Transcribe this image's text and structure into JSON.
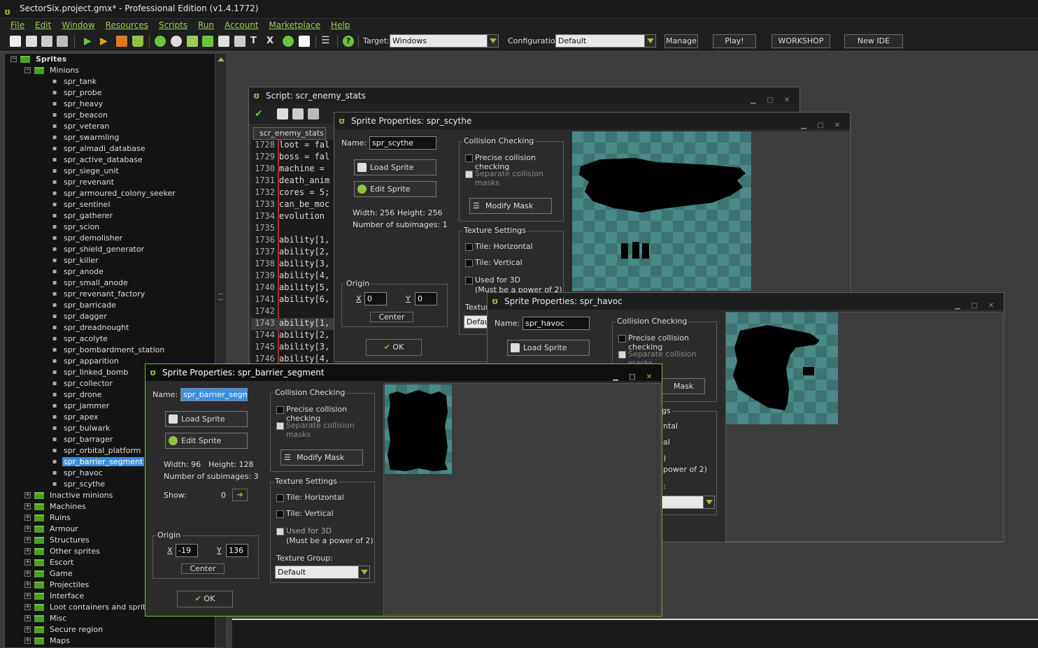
{
  "app": {
    "title": "SectorSix.project.gmx*  -  Professional Edition (v1.4.1772)"
  },
  "menu": [
    "File",
    "Edit",
    "Window",
    "Resources",
    "Scripts",
    "Run",
    "Account",
    "Marketplace",
    "Help"
  ],
  "toolbar": {
    "target_label": "Target:",
    "target_value": "Windows",
    "config_label": "Configuration:",
    "config_value": "Default",
    "manage": "Manage",
    "play": "Play!",
    "workshop": "WORKSHOP",
    "new_ide": "New IDE"
  },
  "tree": {
    "root": "Sprites",
    "group": "Minions",
    "sprites": [
      "spr_tank",
      "spr_probe",
      "spr_heavy",
      "spr_beacon",
      "spr_veteran",
      "spr_swarmling",
      "spr_almadi_database",
      "spr_active_database",
      "spr_siege_unit",
      "spr_revenant",
      "spr_armoured_colony_seeker",
      "spr_sentinel",
      "spr_gatherer",
      "spr_scion",
      "spr_demolisher",
      "spr_shield_generator",
      "spr_killer",
      "spr_anode",
      "spr_small_anode",
      "spr_revenant_factory",
      "spr_barricade",
      "spr_dagger",
      "spr_dreadnought",
      "spr_acolyte",
      "spr_bombardment_station",
      "spr_apparition",
      "spr_linked_bomb",
      "spr_collector",
      "spr_drone",
      "spr_jammer",
      "spr_apex",
      "spr_bulwark",
      "spr_barrager",
      "spr_orbital_platform",
      "spr_barrier_segment",
      "spr_havoc",
      "spr_scythe"
    ],
    "selected": "spr_barrier_segment",
    "folders": [
      "Inactive minions",
      "Machines",
      "Ruins",
      "Armour",
      "Structures",
      "Other sprites",
      "Escort",
      "Game",
      "Projectiles",
      "Interface",
      "Loot containers and sprites",
      "Misc",
      "Secure region",
      "Maps"
    ]
  },
  "script_window": {
    "title": "Script: scr_enemy_stats",
    "tab": "scr_enemy_stats",
    "lines": [
      {
        "n": "1728",
        "code": "loot = fal"
      },
      {
        "n": "1729",
        "code": "boss = fal"
      },
      {
        "n": "1730",
        "code": "machine = "
      },
      {
        "n": "1731",
        "code": "death_anim"
      },
      {
        "n": "1732",
        "code": "cores = 5;"
      },
      {
        "n": "1733",
        "code": "can_be_moc"
      },
      {
        "n": "1734",
        "code": "evolution "
      },
      {
        "n": "1735",
        "code": ""
      },
      {
        "n": "1736",
        "code": "ability[1,"
      },
      {
        "n": "1737",
        "code": "ability[2,"
      },
      {
        "n": "1738",
        "code": "ability[3,"
      },
      {
        "n": "1739",
        "code": "ability[4,"
      },
      {
        "n": "1740",
        "code": "ability[5,"
      },
      {
        "n": "1741",
        "code": "ability[6,"
      },
      {
        "n": "1742",
        "code": ""
      },
      {
        "n": "1743",
        "code": "ability[1,"
      },
      {
        "n": "1744",
        "code": "ability[2,"
      },
      {
        "n": "1745",
        "code": "ability[3,"
      },
      {
        "n": "1746",
        "code": "ability[4,"
      }
    ]
  },
  "scythe": {
    "title": "Sprite Properties: spr_scythe",
    "name_label": "Name:",
    "name": "spr_scythe",
    "load": "Load Sprite",
    "edit": "Edit Sprite",
    "width_text": "Width: 256",
    "height_text": "Height: 256",
    "subimages": "Number of subimages: 1",
    "collision": "Collision Checking",
    "precise": "Precise collision checking",
    "separate": "Separate collision masks",
    "modify": "Modify Mask",
    "texture": "Texture Settings",
    "tile_h": "Tile: Horizontal",
    "tile_v": "Tile: Vertical",
    "used3d": "Used for 3D",
    "power2": "(Must be a power of 2)",
    "texture_group": "Texture Group:",
    "texture_value": "Defau",
    "origin": "Origin",
    "x_label": "X",
    "y_label": "Y",
    "x": "0",
    "y": "0",
    "center": "Center",
    "ok": "OK"
  },
  "havoc": {
    "title": "Sprite Properties: spr_havoc",
    "name_label": "Name:",
    "name": "spr_havoc",
    "load": "Load Sprite",
    "collision": "Collision Checking",
    "precise": "Precise collision checking",
    "separate": "Separate collision masks",
    "modify_partial": "Mask",
    "tex_partial": "gs",
    "tile_h_partial": "ntal",
    "tile_v_partial": "al",
    "d_partial": ")",
    "power_partial": "power of 2)",
    "colon": ":"
  },
  "barrier": {
    "title": "Sprite Properties: spr_barrier_segment",
    "name_label": "Name:",
    "name": "spr_barrier_segment",
    "load": "Load Sprite",
    "edit": "Edit Sprite",
    "width_text": "Width: 96",
    "height_text": "Height: 128",
    "subimages": "Number of subimages: 3",
    "show_label": "Show:",
    "show_value": "0",
    "collision": "Collision Checking",
    "precise": "Precise collision checking",
    "separate": "Separate collision masks",
    "modify": "Modify Mask",
    "texture": "Texture Settings",
    "tile_h": "Tile: Horizontal",
    "tile_v": "Tile: Vertical",
    "used3d": "Used for 3D",
    "power2": "(Must be a power of 2)",
    "texture_group": "Texture Group:",
    "texture_value": "Default",
    "origin": "Origin",
    "x_label": "X",
    "y_label": "Y",
    "x": "-19",
    "y": "136",
    "center": "Center",
    "ok": "OK"
  },
  "colors": {
    "accent": "#8fc43e",
    "selection": "#3d8ee0",
    "checker": "#4a8a87"
  }
}
